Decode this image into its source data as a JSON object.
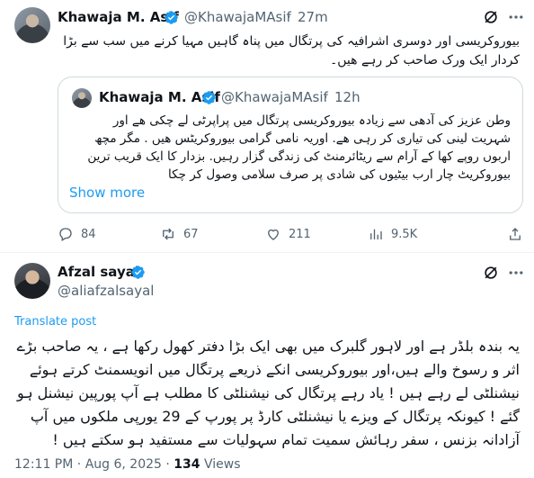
{
  "quote_post": {
    "author_name": "Khawaja M. Asif",
    "author_handle": "@KhawajaMAsif",
    "separator": "·",
    "time": "27m",
    "text_lines": [
      "بیوروکریسی اور دوسری اشرافیہ کی پرتگال میں پناہ گاہیں مہیا کرنے میں سب سے بڑا",
      "کردار ایک ورک صاحب کر رہے ھیں۔"
    ],
    "actions": {
      "replies": "84",
      "reposts": "67",
      "likes": "211",
      "views": "9.5K"
    }
  },
  "quoted_post": {
    "author_name": "Khawaja M. Asif",
    "author_handle": "@KhawajaMAsif",
    "separator": "·",
    "time": "12h",
    "text_lines": [
      "وطن عزیز کی آدھی سے زیادہ بیوروکریسی پرتگال میں پراپرٹی لے چکی ھے اور",
      "شہریت لینی کی تیاری کر رہی ھے. اوریہ نامی گرامی بیوروکریٹس ھیں . مگر مچھ",
      "اربوں روپے کھا کے آرام سے ریٹائرمنٹ کی زندگی گزار رہیں. بزدار کا ایک قریب ترین",
      "بیوروکریٹ چار ارب بیٹیوں کی شادی پر صرف سلامی وصول کر چکا"
    ],
    "show_more": "Show more"
  },
  "reply_post": {
    "author_name": "Afzal sayal",
    "author_handle": "@aliafzalsayal",
    "translate_label": "Translate post",
    "text_lines": [
      "یہ بندہ بلڈر ہے اور لاہور گلبرک میں بھی ایک بڑا دفتر کھول رکھا ہے ، یہ صاحب بڑے",
      "اثر و رسوخ والے ہیں،اور بیوروکریسی انکے ذریعے پرتگال میں انویسمنٹ کرتے ہوئے",
      "نیشنلٹی لے رہے ہیں ! یاد رہے پرتگال کی نیشنلٹی کا مطلب ہے آپ پورپین نیشنل ہو",
      "گئے ! کیونکہ پرتگال کے ویزے یا نیشنلٹی کارڈ پر پورپ کے 29 یورپی ملکوں میں آپ",
      "آزادانہ بزنس ، سفر رہائش سمیت تمام سہولیات سے مستفید ہو سکتے ہیں !"
    ],
    "time": "12:11 PM",
    "date": "Aug 6, 2025",
    "views_count": "134",
    "views_label": "Views",
    "dot": "·"
  },
  "icons": {
    "verified": "verified-badge-icon",
    "grok": "grok-icon",
    "more": "more-dots-icon",
    "reply": "reply-icon",
    "repost": "repost-icon",
    "like": "heart-icon",
    "views": "views-bar-chart-icon",
    "share": "share-icon"
  },
  "colors": {
    "accent": "#1d9bf0",
    "secondary_text": "#536471",
    "border": "#cfd9de"
  }
}
